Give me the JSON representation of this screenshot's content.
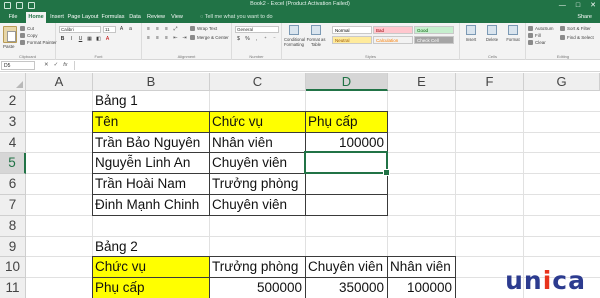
{
  "window": {
    "title": "Book2 - Excel (Product Activation Failed)",
    "controls": [
      "—",
      "□",
      "✕"
    ]
  },
  "ribbon_tabs": {
    "file": "File",
    "tabs": [
      "Home",
      "Insert",
      "Page Layout",
      "Formulas",
      "Data",
      "Review",
      "View"
    ],
    "active": "Home",
    "tell_me": "Tell me what you want to do",
    "share": "Share"
  },
  "ribbon": {
    "clipboard": {
      "paste": "Paste",
      "cut": "Cut",
      "copy": "Copy",
      "format_painter": "Format Painter",
      "label": "Clipboard"
    },
    "font": {
      "name": "Calibri",
      "size": "11",
      "label": "Font"
    },
    "alignment": {
      "wrap": "Wrap Text",
      "merge": "Merge & Center",
      "label": "Alignment"
    },
    "number": {
      "format": "General",
      "label": "Number"
    },
    "styles": {
      "conditional": "Conditional Formatting",
      "format_as_table": "Format as Table",
      "cells": [
        {
          "name": "Normal",
          "bg": "#ffffff",
          "fg": "#000000"
        },
        {
          "name": "Bad",
          "bg": "#ffc7ce",
          "fg": "#9c0006"
        },
        {
          "name": "Good",
          "bg": "#c6efce",
          "fg": "#006100"
        },
        {
          "name": "Neutral",
          "bg": "#ffeb9c",
          "fg": "#9c5700"
        },
        {
          "name": "Calculation",
          "bg": "#f2f2f2",
          "fg": "#fa7d00"
        },
        {
          "name": "Check Cell",
          "bg": "#a5a5a5",
          "fg": "#ffffff"
        }
      ],
      "label": "Styles"
    },
    "cells": {
      "insert": "Insert",
      "delete": "Delete",
      "format": "Format",
      "label": "Cells"
    },
    "editing": {
      "autosum": "AutoSum",
      "fill": "Fill",
      "clear": "Clear",
      "sort_filter": "Sort & Filter",
      "find_select": "Find & Select",
      "label": "Editing"
    }
  },
  "formula_bar": {
    "name_box": "D5",
    "cancel": "✕",
    "enter": "✓",
    "fx": "fx",
    "value": ""
  },
  "sheet": {
    "columns": [
      "A",
      "B",
      "C",
      "D",
      "E",
      "F",
      "G"
    ],
    "selected_column": "D",
    "rows": [
      "2",
      "3",
      "4",
      "5",
      "6",
      "7",
      "8",
      "9",
      "10",
      "11"
    ],
    "selected_row": "5",
    "cells": {
      "B2": "Bảng 1",
      "B3": "Tên",
      "C3": "Chức vụ",
      "D3": "Phụ cấp",
      "B4": "Trần Bảo Nguyên",
      "C4": "Nhân viên",
      "D4": "100000",
      "B5": "Nguyễn Linh An",
      "C5": "Chuyên viên",
      "B6": "Trần Hoài Nam",
      "C6": "Trưởng phòng",
      "B7": "Đinh Mạnh Chinh",
      "C7": "Chuyên viên",
      "B9": "Bảng 2",
      "B10": "Chức vụ",
      "C10": "Trưởng phòng",
      "D10": "Chuyên viên",
      "E10": "Nhân viên",
      "B11": "Phụ cấp",
      "C11": "500000",
      "D11": "350000",
      "E11": "100000"
    },
    "highlight_color": "#ffff00",
    "accent": "#217346"
  },
  "logo": {
    "text_before": "un",
    "dot_letter": "i",
    "text_after": "ca"
  }
}
